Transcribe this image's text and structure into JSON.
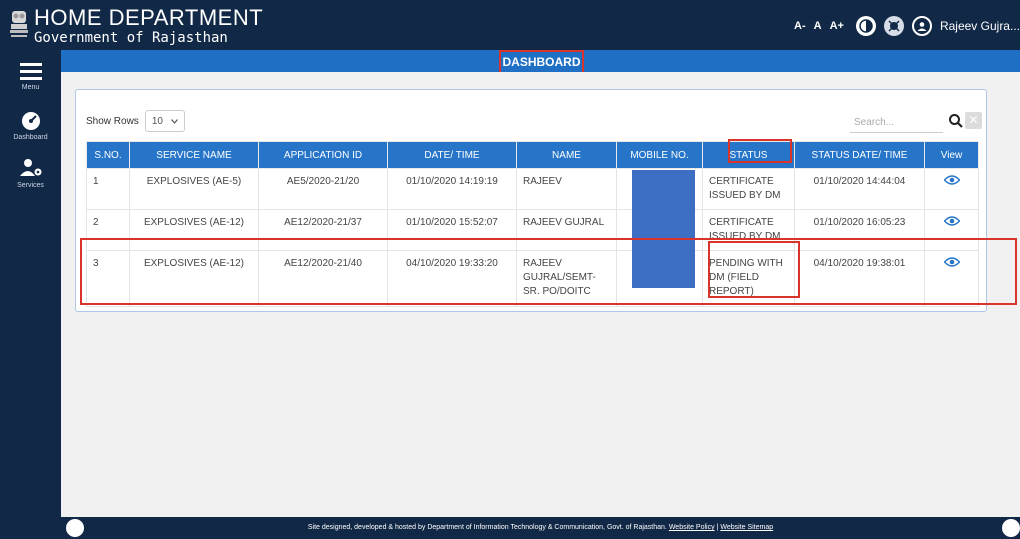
{
  "header": {
    "title": "HOME DEPARTMENT",
    "subtitle": "Government of Rajasthan",
    "font_controls": [
      "A-",
      "A",
      "A+"
    ],
    "user_name": "Rajeev Gujra..."
  },
  "sidebar": {
    "items": [
      {
        "label": "Menu",
        "icon": "hamburger-icon"
      },
      {
        "label": "Dashboard",
        "icon": "dashboard-gauge-icon"
      },
      {
        "label": "Services",
        "icon": "user-gear-icon"
      }
    ]
  },
  "page": {
    "title": "DASHBOARD"
  },
  "controls": {
    "show_rows_label": "Show Rows",
    "rows_value": "10",
    "search_placeholder": "Search..."
  },
  "table": {
    "columns": [
      "S.NO.",
      "SERVICE NAME",
      "APPLICATION ID",
      "DATE/ TIME",
      "NAME",
      "MOBILE NO.",
      "STATUS",
      "STATUS DATE/ TIME",
      "View"
    ],
    "rows": [
      {
        "sno": "1",
        "service": "EXPLOSIVES (AE-5)",
        "app_id": "AE5/2020-21/20",
        "datetime": "01/10/2020 14:19:19",
        "name": "RAJEEV",
        "mobile": "",
        "status": "CERTIFICATE ISSUED BY DM",
        "status_datetime": "01/10/2020 14:44:04"
      },
      {
        "sno": "2",
        "service": "EXPLOSIVES (AE-12)",
        "app_id": "AE12/2020-21/37",
        "datetime": "01/10/2020 15:52:07",
        "name": "RAJEEV GUJRAL",
        "mobile": "",
        "status": "CERTIFICATE ISSUED BY DM",
        "status_datetime": "01/10/2020 16:05:23"
      },
      {
        "sno": "3",
        "service": "EXPLOSIVES (AE-12)",
        "app_id": "AE12/2020-21/40",
        "datetime": "04/10/2020 19:33:20",
        "name": "RAJEEV GUJRAL/SEMT-SR. PO/DOITC",
        "mobile": "",
        "status": "PENDING WITH DM (FIELD REPORT)",
        "status_datetime": "04/10/2020 19:38:01"
      }
    ]
  },
  "footer": {
    "text": "Site designed, developed & hosted by Department of Information Technology & Communication, Govt. of Rajasthan.",
    "link1": "Website Policy",
    "separator": "|",
    "link2": "Website Sitemap"
  },
  "colors": {
    "nav": "#112846",
    "accent": "#1f6fc5",
    "table_header": "#2775c8",
    "highlight": "#d9342b",
    "redaction": "#3c6fc4"
  }
}
